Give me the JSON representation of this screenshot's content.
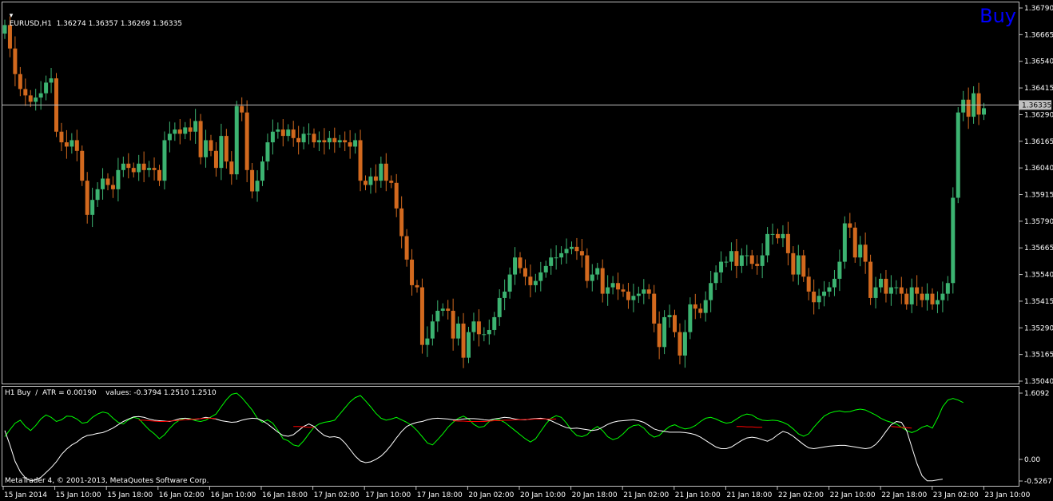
{
  "main": {
    "symbol_header": "EURUSD,H1  1.36274 1.36357 1.36269 1.36335",
    "signal_label": "Buy",
    "current_price_label": "1.36335"
  },
  "indicator": {
    "header": "H1 Buy  /  ATR = 0.00190    values: -0.3794 1.2510 1.2510",
    "copyright": "MetaTrader 4, © 2001-2013, MetaQuotes Software Corp."
  },
  "colors": {
    "background": "#000000",
    "bull": "#3cb371",
    "bear": "#d2691e",
    "grid_line": "#c0c0c0",
    "signal": "#0000ff",
    "green_line": "#00ff00",
    "white_line": "#ffffff",
    "red_line": "#ff0000"
  },
  "chart_data": [
    {
      "type": "candlestick",
      "symbol": "EURUSD",
      "timeframe": "H1",
      "ylim": [
        1.3504,
        1.3679
      ],
      "price_ticks": [
        "1.36790",
        "1.36665",
        "1.36540",
        "1.36415",
        "1.36290",
        "1.36165",
        "1.36040",
        "1.35915",
        "1.35790",
        "1.35665",
        "1.35540",
        "1.35415",
        "1.35290",
        "1.35165",
        "1.35040"
      ],
      "current_price": 1.36335,
      "x_labels": [
        "15 Jan 2014",
        "15 Jan 10:00",
        "15 Jan 18:00",
        "16 Jan 02:00",
        "16 Jan 10:00",
        "16 Jan 18:00",
        "17 Jan 02:00",
        "17 Jan 10:00",
        "17 Jan 18:00",
        "20 Jan 02:00",
        "20 Jan 10:00",
        "20 Jan 18:00",
        "21 Jan 02:00",
        "21 Jan 10:00",
        "21 Jan 18:00",
        "22 Jan 02:00",
        "22 Jan 10:00",
        "22 Jan 18:00",
        "23 Jan 02:00",
        "23 Jan 10:00"
      ],
      "closes": [
        1.3671,
        1.366,
        1.3648,
        1.3641,
        1.3638,
        1.3635,
        1.3637,
        1.3639,
        1.3644,
        1.3646,
        1.3621,
        1.3616,
        1.3614,
        1.3617,
        1.3612,
        1.3598,
        1.3582,
        1.3589,
        1.3594,
        1.3599,
        1.3596,
        1.3594,
        1.3603,
        1.3606,
        1.3604,
        1.3602,
        1.3606,
        1.3603,
        1.3604,
        1.3603,
        1.3598,
        1.3617,
        1.362,
        1.3622,
        1.362,
        1.3623,
        1.3621,
        1.3626,
        1.3609,
        1.3617,
        1.3612,
        1.3604,
        1.3619,
        1.3607,
        1.3601,
        1.3633,
        1.363,
        1.3603,
        1.3593,
        1.3598,
        1.3607,
        1.3616,
        1.3621,
        1.3622,
        1.3619,
        1.3622,
        1.3618,
        1.3616,
        1.362,
        1.362,
        1.3616,
        1.3617,
        1.3616,
        1.3618,
        1.3616,
        1.3617,
        1.3616,
        1.3614,
        1.3617,
        1.3598,
        1.3596,
        1.36,
        1.3598,
        1.3606,
        1.3598,
        1.3597,
        1.3585,
        1.3572,
        1.3561,
        1.3549,
        1.3548,
        1.3521,
        1.3524,
        1.3532,
        1.3537,
        1.3538,
        1.3537,
        1.3524,
        1.3531,
        1.3515,
        1.3527,
        1.3532,
        1.3526,
        1.3526,
        1.3528,
        1.3534,
        1.3543,
        1.3546,
        1.3554,
        1.3562,
        1.3557,
        1.3553,
        1.3549,
        1.3551,
        1.3555,
        1.3558,
        1.3562,
        1.3562,
        1.3564,
        1.3566,
        1.3567,
        1.3565,
        1.3563,
        1.3551,
        1.3554,
        1.3557,
        1.3545,
        1.3548,
        1.355,
        1.3547,
        1.3546,
        1.3542,
        1.3544,
        1.3545,
        1.3547,
        1.3545,
        1.3531,
        1.352,
        1.3534,
        1.3535,
        1.3527,
        1.3516,
        1.3527,
        1.354,
        1.3538,
        1.3536,
        1.3542,
        1.355,
        1.3555,
        1.356,
        1.356,
        1.3565,
        1.3558,
        1.3563,
        1.3563,
        1.3559,
        1.3558,
        1.3563,
        1.3573,
        1.3573,
        1.3571,
        1.3573,
        1.3564,
        1.3554,
        1.3563,
        1.3553,
        1.3546,
        1.3541,
        1.3544,
        1.3546,
        1.3548,
        1.3552,
        1.356,
        1.3578,
        1.3576,
        1.3562,
        1.3568,
        1.356,
        1.3543,
        1.3548,
        1.3552,
        1.3545,
        1.3548,
        1.3548,
        1.3545,
        1.354,
        1.3548,
        1.3545,
        1.3542,
        1.3545,
        1.354,
        1.3542,
        1.3545,
        1.355,
        1.359,
        1.363,
        1.3636,
        1.3628,
        1.3639,
        1.3629,
        1.3632
      ]
    },
    {
      "type": "line",
      "title": "H1 Buy",
      "ylim": [
        -0.5267,
        1.6092
      ],
      "ticks": [
        "1.6092",
        "0.00",
        "-0.5267"
      ],
      "series": [
        {
          "color": "green",
          "values": [
            0.55,
            0.72,
            0.88,
            0.95,
            0.8,
            0.7,
            0.82,
            0.98,
            1.08,
            1.02,
            0.92,
            0.96,
            1.05,
            1.04,
            0.98,
            0.88,
            0.9,
            1.02,
            1.1,
            1.15,
            1.12,
            1.0,
            0.9,
            0.86,
            0.96,
            1.02,
            0.99,
            0.85,
            0.72,
            0.62,
            0.5,
            0.6,
            0.75,
            0.88,
            0.96,
            1.0,
            0.99,
            0.94,
            0.92,
            0.95,
            1.03,
            1.1,
            1.28,
            1.45,
            1.58,
            1.61,
            1.5,
            1.35,
            1.2,
            1.0,
            0.9,
            0.96,
            0.88,
            0.7,
            0.5,
            0.45,
            0.35,
            0.32,
            0.45,
            0.62,
            0.78,
            0.86,
            0.9,
            0.92,
            0.95,
            1.1,
            1.25,
            1.4,
            1.5,
            1.55,
            1.42,
            1.28,
            1.12,
            1.0,
            0.95,
            0.98,
            1.02,
            0.96,
            0.9,
            0.82,
            0.7,
            0.55,
            0.4,
            0.35,
            0.48,
            0.62,
            0.78,
            0.9,
            1.0,
            1.05,
            0.98,
            0.85,
            0.78,
            0.8,
            0.92,
            0.98,
            0.96,
            0.9,
            0.8,
            0.7,
            0.6,
            0.5,
            0.42,
            0.5,
            0.68,
            0.86,
            1.0,
            1.06,
            1.02,
            0.88,
            0.7,
            0.58,
            0.55,
            0.6,
            0.72,
            0.8,
            0.7,
            0.55,
            0.48,
            0.52,
            0.62,
            0.75,
            0.82,
            0.84,
            0.76,
            0.62,
            0.54,
            0.58,
            0.7,
            0.8,
            0.84,
            0.78,
            0.74,
            0.76,
            0.82,
            0.92,
            1.0,
            1.02,
            0.98,
            0.92,
            0.88,
            0.9,
            0.98,
            1.06,
            1.1,
            1.08,
            1.0,
            0.95,
            0.94,
            0.95,
            0.94,
            0.9,
            0.84,
            0.74,
            0.62,
            0.56,
            0.62,
            0.78,
            0.92,
            1.05,
            1.12,
            1.16,
            1.18,
            1.15,
            1.16,
            1.2,
            1.22,
            1.2,
            1.14,
            1.08,
            1.0,
            0.94,
            0.9,
            0.86,
            0.78,
            0.7,
            0.65,
            0.7,
            0.78,
            0.82,
            0.76,
            1.0,
            1.28,
            1.44,
            1.48,
            1.44,
            1.38
          ]
        },
        {
          "color": "white",
          "values": [
            0.7,
            0.35,
            -0.05,
            -0.3,
            -0.45,
            -0.52,
            -0.5,
            -0.44,
            -0.32,
            -0.2,
            -0.06,
            0.12,
            0.25,
            0.35,
            0.42,
            0.52,
            0.58,
            0.6,
            0.63,
            0.65,
            0.7,
            0.76,
            0.84,
            0.92,
            0.98,
            1.03,
            1.04,
            1.02,
            0.98,
            0.95,
            0.94,
            0.93,
            0.92,
            0.95,
            0.99,
            1.0,
            0.98,
            0.97,
            0.99,
            1.02,
            1.0,
            0.98,
            0.94,
            0.92,
            0.9,
            0.91,
            0.95,
            0.98,
            1.0,
            0.99,
            0.94,
            0.86,
            0.76,
            0.66,
            0.58,
            0.56,
            0.6,
            0.7,
            0.8,
            0.86,
            0.8,
            0.68,
            0.58,
            0.54,
            0.55,
            0.52,
            0.4,
            0.24,
            0.08,
            -0.04,
            -0.08,
            -0.06,
            0.0,
            0.08,
            0.2,
            0.35,
            0.52,
            0.68,
            0.8,
            0.86,
            0.9,
            0.92,
            0.96,
            0.99,
            1.0,
            0.99,
            0.98,
            0.96,
            0.96,
            0.98,
            0.99,
            0.99,
            0.98,
            0.96,
            0.95,
            0.98,
            1.0,
            1.02,
            1.01,
            0.98,
            0.96,
            0.96,
            0.98,
            0.99,
            1.0,
            0.98,
            0.94,
            0.88,
            0.82,
            0.77,
            0.75,
            0.76,
            0.74,
            0.72,
            0.7,
            0.72,
            0.78,
            0.85,
            0.9,
            0.93,
            0.94,
            0.95,
            0.96,
            0.94,
            0.9,
            0.82,
            0.74,
            0.7,
            0.68,
            0.66,
            0.66,
            0.66,
            0.65,
            0.63,
            0.6,
            0.54,
            0.46,
            0.38,
            0.3,
            0.26,
            0.26,
            0.3,
            0.38,
            0.46,
            0.52,
            0.54,
            0.52,
            0.48,
            0.44,
            0.5,
            0.6,
            0.68,
            0.64,
            0.56,
            0.46,
            0.36,
            0.28,
            0.26,
            0.28,
            0.3,
            0.32,
            0.33,
            0.34,
            0.34,
            0.32,
            0.3,
            0.28,
            0.26,
            0.28,
            0.36,
            0.5,
            0.68,
            0.84,
            0.92,
            0.9,
            0.7,
            0.3,
            -0.1,
            -0.4,
            -0.52,
            -0.52,
            -0.5,
            -0.48
          ]
        },
        {
          "color": "red",
          "values": [
            null,
            null,
            null,
            null,
            null,
            null,
            null,
            null,
            null,
            null,
            null,
            null,
            null,
            null,
            null,
            null,
            null,
            null,
            null,
            null,
            null,
            null,
            null,
            null,
            null,
            null,
            0.95,
            0.95,
            0.94,
            0.93,
            0.92,
            0.92,
            0.93,
            0.94,
            0.95,
            0.96,
            0.97,
            0.98,
            0.99,
            1.0,
            1.0,
            0.99,
            null,
            null,
            null,
            null,
            null,
            null,
            null,
            null,
            null,
            null,
            null,
            null,
            null,
            null,
            0.8,
            0.8,
            0.79,
            0.78,
            0.78,
            null,
            null,
            null,
            null,
            null,
            null,
            null,
            null,
            null,
            null,
            null,
            null,
            null,
            null,
            null,
            null,
            null,
            null,
            null,
            null,
            null,
            null,
            null,
            null,
            null,
            null,
            0.94,
            0.93,
            0.93,
            0.92,
            0.92,
            0.92,
            0.92,
            0.93,
            0.94,
            0.94,
            0.95,
            0.95,
            0.96,
            0.96,
            0.97,
            0.97,
            0.98,
            0.98,
            0.98,
            0.98,
            0.98,
            null,
            null,
            null,
            null,
            null,
            null,
            null,
            null,
            null,
            null,
            null,
            null,
            null,
            null,
            null,
            null,
            null,
            null,
            null,
            null,
            null,
            null,
            null,
            null,
            null,
            null,
            null,
            null,
            null,
            null,
            null,
            null,
            null,
            null,
            0.8,
            0.8,
            0.79,
            0.79,
            0.78,
            0.78,
            null,
            null,
            null,
            null,
            null,
            null,
            null,
            null,
            null,
            null,
            null,
            null,
            null,
            null,
            null,
            null,
            null,
            null,
            null,
            null,
            null,
            null,
            null,
            null,
            0.8,
            0.79,
            0.78,
            0.77,
            0.76,
            null,
            null,
            null,
            null,
            null
          ]
        }
      ]
    }
  ]
}
